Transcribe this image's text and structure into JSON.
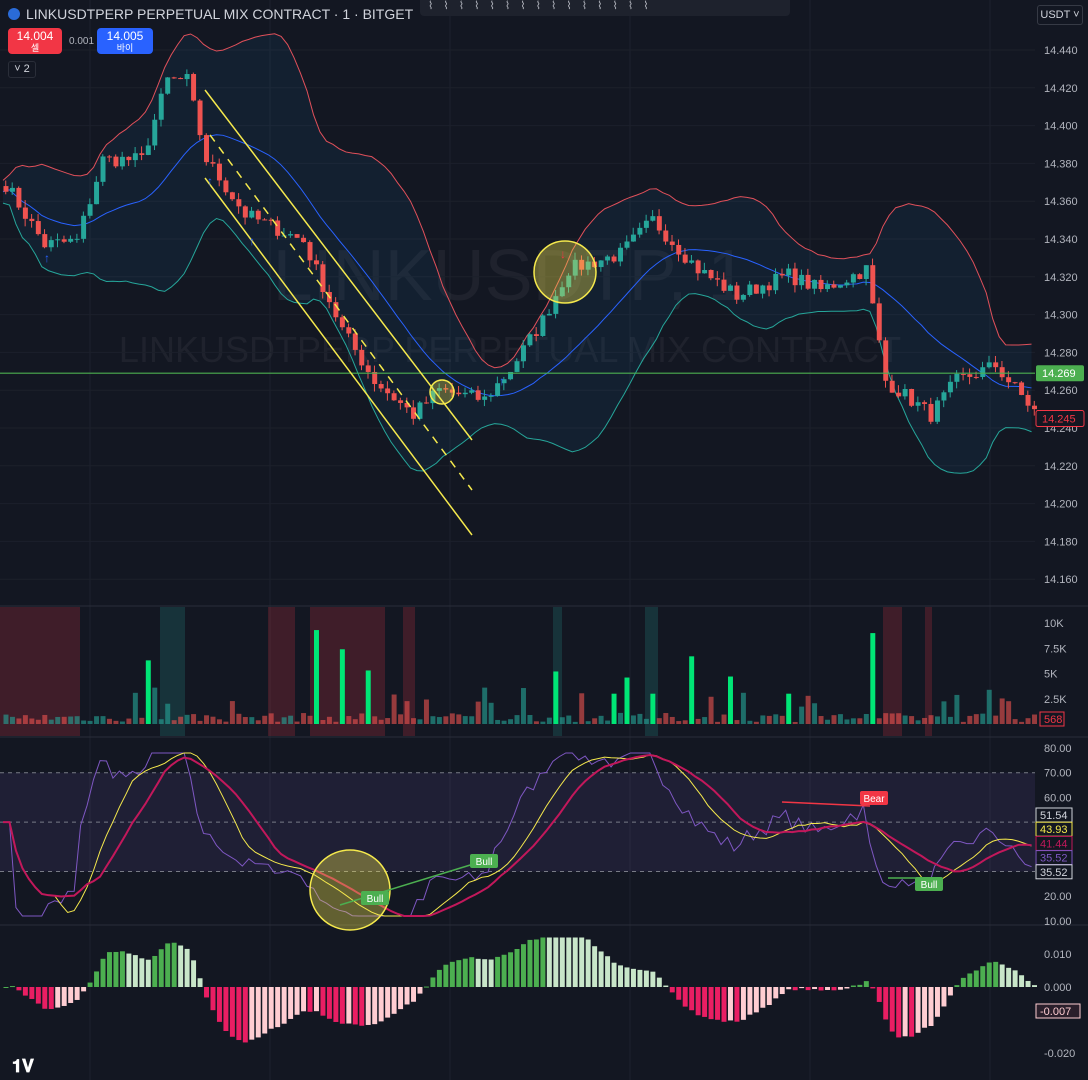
{
  "header": {
    "symbol": "LINKUSDTPERP PERPETUAL MIX CONTRACT · 1 · BITGET",
    "sell_price": "14.004",
    "sell_label": "셀",
    "spread": "0.001",
    "buy_price": "14.005",
    "buy_label": "바이",
    "indicators_count": "2",
    "currency": "USDT",
    "logo_text": "TV"
  },
  "toolbar": {
    "icons": [
      "hline",
      "parallel",
      "fib",
      "path",
      "zigzag",
      "range",
      "gann",
      "rect",
      "pin",
      "anchor",
      "circle",
      "ray",
      "trendline",
      "pitchfork",
      "elliott"
    ]
  },
  "watermark": {
    "line1": "LINKUSDTP, 1",
    "line2": "LINKUSDTPERP PERPETUAL MIX CONTRACT"
  },
  "colors": {
    "up": "#26a69a",
    "down": "#ef5350",
    "bb_upper": "#e0505a",
    "bb_lower": "#26a69a",
    "bb_basis": "#2962ff",
    "hline": "#4caf50",
    "channel": "#f5e94d"
  },
  "chart_data": {
    "type": "candlestick",
    "candle_count": 160,
    "close_anchors": [
      [
        0,
        14.369
      ],
      [
        6,
        14.337
      ],
      [
        11,
        14.339
      ],
      [
        15,
        14.382
      ],
      [
        21,
        14.382
      ],
      [
        25,
        14.424
      ],
      [
        28,
        14.424
      ],
      [
        31,
        14.382
      ],
      [
        37,
        14.353
      ],
      [
        46,
        14.339
      ],
      [
        52,
        14.292
      ],
      [
        57,
        14.265
      ],
      [
        63,
        14.247
      ],
      [
        67,
        14.26
      ],
      [
        74,
        14.255
      ],
      [
        78,
        14.271
      ],
      [
        83,
        14.297
      ],
      [
        87,
        14.324
      ],
      [
        95,
        14.332
      ],
      [
        100,
        14.35
      ],
      [
        107,
        14.324
      ],
      [
        113,
        14.31
      ],
      [
        121,
        14.321
      ],
      [
        126,
        14.313
      ],
      [
        133,
        14.324
      ],
      [
        136,
        14.265
      ],
      [
        143,
        14.247
      ],
      [
        147,
        14.265
      ],
      [
        153,
        14.273
      ],
      [
        159,
        14.249
      ]
    ],
    "price_axis": {
      "ticks": [
        "14.440",
        "14.420",
        "14.400",
        "14.380",
        "14.360",
        "14.340",
        "14.320",
        "14.300",
        "14.280",
        "14.260",
        "14.240",
        "14.220",
        "14.200",
        "14.180",
        "14.160"
      ],
      "min": 14.16,
      "max": 14.44
    },
    "horizontal_line": {
      "value": 14.269,
      "label": "14.269"
    },
    "last_price": "14.245",
    "volume": {
      "ticks": [
        "10K",
        "7.5K",
        "5K",
        "2.5K"
      ],
      "last": "568",
      "max": 10000
    },
    "rsi": {
      "ticks": [
        "80.00",
        "70.00",
        "60.00",
        "20.00",
        "10.00"
      ],
      "values": [
        "51.54",
        "43.93",
        "41.44",
        "35.52",
        "35.52"
      ],
      "labels": [
        "Bull",
        "Bull",
        "Bear",
        "Bull"
      ]
    },
    "macd": {
      "ticks": [
        "0.010",
        "0.000",
        "-0.020"
      ],
      "last": "-0.007"
    }
  }
}
